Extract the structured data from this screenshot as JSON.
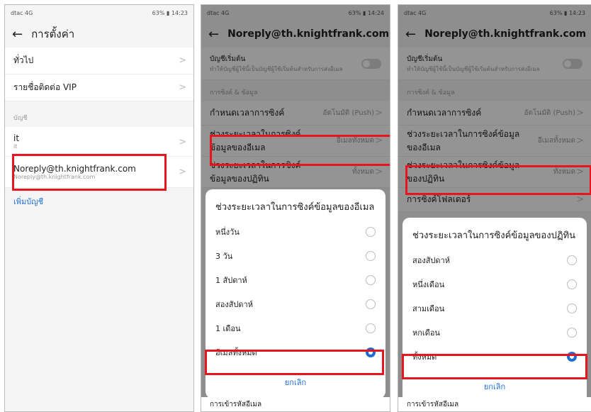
{
  "panel1": {
    "status_left": "dtac 4G",
    "status_right": "63% ▮ 14:23",
    "title": "การตั้งค่า",
    "general": "ทั่วไป",
    "vip": "รายชื่อติดต่อ VIP",
    "section_accounts": "บัญชี",
    "account1_name": "it",
    "account1_email": "it",
    "account2_name": "Noreply@th.knightfrank.com",
    "account2_email": "Noreply@th.knightfrank.com",
    "add_account": "เพิ่มบัญชี"
  },
  "panel2": {
    "status_left": "dtac 4G",
    "status_right": "63% ▮ 14:24",
    "title": "Noreply@th.knightfrank.com",
    "default_account_title": "บัญชีเริ่มต้น",
    "default_account_desc": "ทำให้บัญชีผู้ใช้นี้เป็นบัญชีผู้ใช้เริ่มต้นสำหรับการส่งอีเมล",
    "section_sync": "การซิงค์ & ข้อมูล",
    "sync_schedule": "กำหนดเวลาการซิงค์",
    "sync_schedule_value": "อัตโนมัติ (Push)",
    "email_sync_period": "ช่วงระยะเวลาในการซิงค์ข้อมูลของอีเมล",
    "email_sync_period_value": "อีเมลทั้งหมด",
    "calendar_sync_period": "ช่วงระยะเวลาในการซิงค์ข้อมูลของปฏิทิน",
    "calendar_sync_period_value": "ทั้งหมด",
    "dialog_title": "ช่วงระยะเวลาในการซิงค์ข้อมูลของอีเมล",
    "options": [
      "หนึ่งวัน",
      "3 วัน",
      "1 สัปดาห์",
      "สองสัปดาห์",
      "1 เดือน",
      "อีเมลทั้งหมด"
    ],
    "selected_index": 5,
    "cancel": "ยกเลิก",
    "peek": "การเข้ารหัสอีเมล"
  },
  "panel3": {
    "status_left": "dtac 4G",
    "status_right": "63% ▮ 14:23",
    "title": "Noreply@th.knightfrank.com",
    "default_account_title": "บัญชีเริ่มต้น",
    "default_account_desc": "ทำให้บัญชีผู้ใช้นี้เป็นบัญชีผู้ใช้เริ่มต้นสำหรับการส่งอีเมล",
    "section_sync": "การซิงค์ & ข้อมูล",
    "sync_schedule": "กำหนดเวลาการซิงค์",
    "sync_schedule_value": "อัตโนมัติ (Push)",
    "email_sync_period": "ช่วงระยะเวลาในการซิงค์ข้อมูลของอีเมล",
    "email_sync_period_value": "อีเมลทั้งหมด",
    "calendar_sync_period": "ช่วงระยะเวลาในการซิงค์ข้อมูลของปฏิทิน",
    "calendar_sync_period_value": "ทั้งหมด",
    "folder_sync": "การซิงค์โฟลเดอร์",
    "dialog_title": "ช่วงระยะเวลาในการซิงค์ข้อมูลของปฏิทิน",
    "options": [
      "สองสัปดาห์",
      "หนึ่งเดือน",
      "สามเดือน",
      "หกเดือน",
      "ทั้งหมด"
    ],
    "selected_index": 4,
    "cancel": "ยกเลิก",
    "peek": "การเข้ารหัสอีเมล"
  },
  "colors": {
    "highlight": "#e8141e",
    "accent": "#1f6fd1"
  }
}
